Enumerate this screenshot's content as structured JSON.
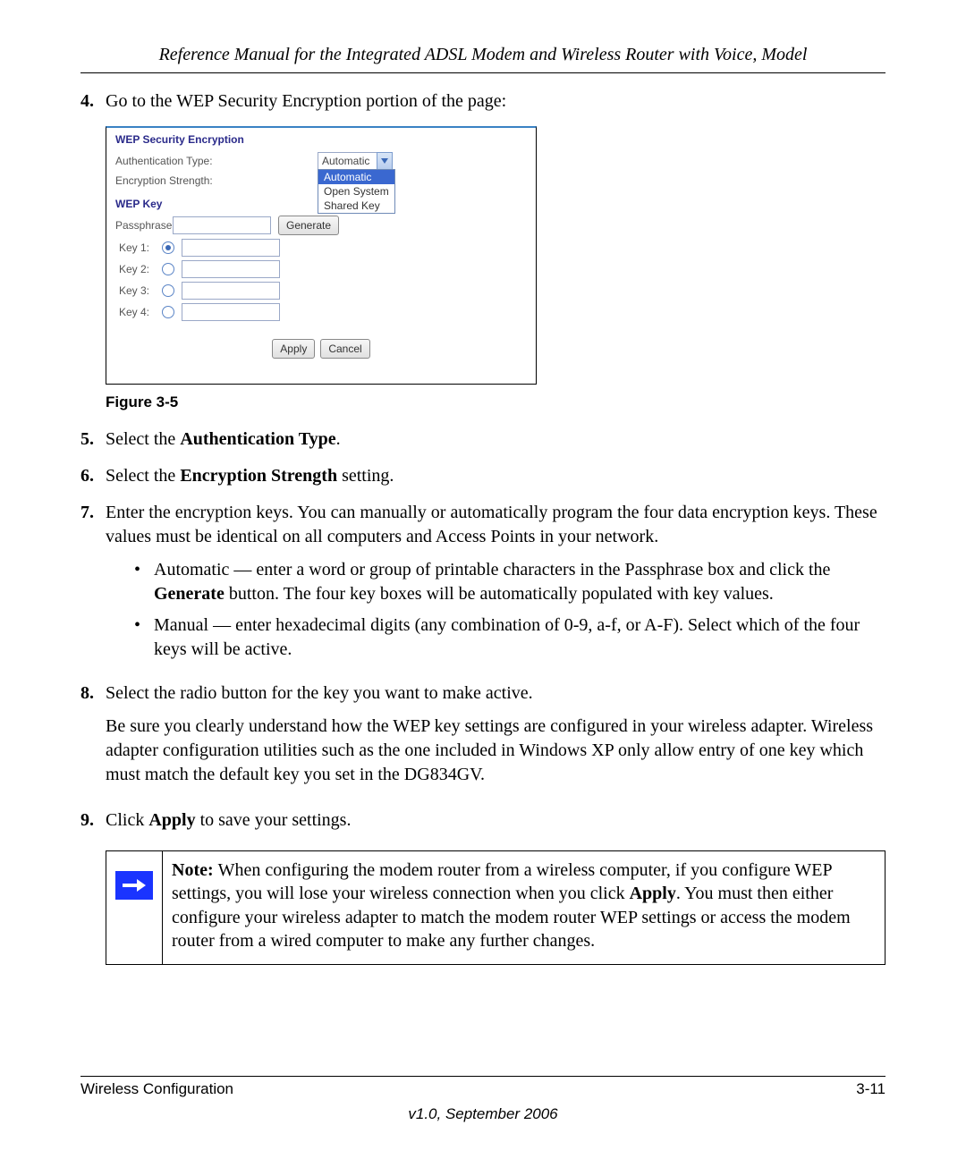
{
  "header": {
    "title": "Reference Manual for the Integrated ADSL Modem and Wireless Router with Voice, Model"
  },
  "steps": {
    "s4": {
      "num": "4.",
      "text": "Go to the WEP Security Encryption portion of the page:"
    },
    "fig_label": "Figure 3-5",
    "s5": {
      "num": "5.",
      "pre": "Select the ",
      "b": "Authentication Type",
      "post": "."
    },
    "s6": {
      "num": "6.",
      "pre": "Select the ",
      "b": "Encryption Strength",
      "post": " setting."
    },
    "s7": {
      "num": "7.",
      "text": "Enter the encryption keys. You can manually or automatically program the four data encryption keys. These values must be identical on all computers and Access Points in your network.",
      "bul1_pre": "Automatic — enter a word or group of printable characters in the Passphrase box and click the ",
      "bul1_b": "Generate",
      "bul1_post": " button. The four key boxes will be automatically populated with key values.",
      "bul2": "Manual — enter hexadecimal digits (any combination of 0-9, a-f, or A-F). Select which of the four keys will be active."
    },
    "s8": {
      "num": "8.",
      "t1": "Select the radio button for the key you want to make active.",
      "t2": "Be sure you clearly understand how the WEP key settings are configured in your wireless adapter. Wireless adapter configuration utilities such as the one included in Windows XP only allow entry of one key which must match the default key you set in the DG834GV."
    },
    "s9": {
      "num": "9.",
      "pre": "Click ",
      "b": "Apply",
      "post": " to save your settings."
    }
  },
  "note": {
    "bold": "Note: ",
    "t1": "When configuring the modem router from a wireless computer, if you configure WEP settings, you will lose your wireless connection when you click ",
    "b": "Apply",
    "t2": ". You must then either configure your wireless adapter to match the modem router WEP settings or access the modem router from a wired computer to make any further changes."
  },
  "shot": {
    "heading": "WEP Security Encryption",
    "auth_label": "Authentication Type:",
    "enc_label": "Encryption Strength:",
    "wepkey": "WEP Key",
    "passphrase": "Passphrase:",
    "generate": "Generate",
    "combo_value": "Automatic",
    "options": [
      "Automatic",
      "Open System",
      "Shared Key"
    ],
    "keys": [
      "Key 1:",
      "Key 2:",
      "Key 3:",
      "Key 4:"
    ],
    "apply": "Apply",
    "cancel": "Cancel"
  },
  "footer": {
    "left": "Wireless Configuration",
    "right": "3-11",
    "version": "v1.0, September 2006"
  }
}
